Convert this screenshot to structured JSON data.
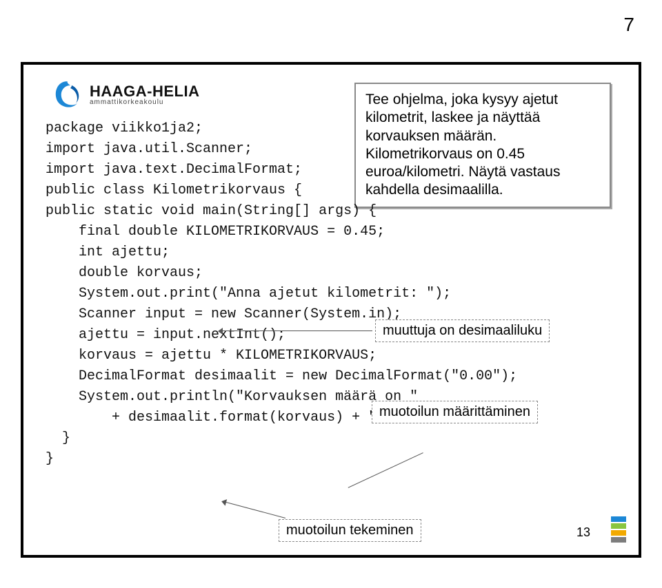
{
  "page_number_top": "7",
  "logo": {
    "main": "HAAGA-HELIA",
    "sub": "ammattikorkeakoulu"
  },
  "task_box": "Tee ohjelma, joka kysyy ajetut kilometrit, laskee ja näyttää korvauksen määrän. Kilometrikorvaus on 0.45 euroa/kilometri. Näytä vastaus kahdella desimaalilla.",
  "code": {
    "l1": "package viikko1ja2;",
    "l2": "import java.util.Scanner;",
    "l3": "import java.text.DecimalFormat;",
    "l4": "public class Kilometrikorvaus {",
    "l5": "public static void main(String[] args) {",
    "l6": "    final double KILOMETRIKORVAUS = 0.45;",
    "l7": "    int ajettu;",
    "l8": "    double korvaus;",
    "l9": "    System.out.print(\"Anna ajetut kilometrit: \");",
    "l10": "    Scanner input = new Scanner(System.in);",
    "l11": "    ajettu = input.nextInt();",
    "l12": "    korvaus = ajettu * KILOMETRIKORVAUS;",
    "l13": "    DecimalFormat desimaalit = new DecimalFormat(\"0.00\");",
    "l14": "    System.out.println(\"Korvauksen määrä on \"",
    "l15": "        + desimaalit.format(korvaus) + \" euroa\");",
    "l16": "  }",
    "l17": "}"
  },
  "annotations": {
    "var_type": "muuttuja on desimaaliluku",
    "format_def": "muotoilun määrittäminen",
    "format_apply": "muotoilun tekeminen"
  },
  "slide_number": "13"
}
